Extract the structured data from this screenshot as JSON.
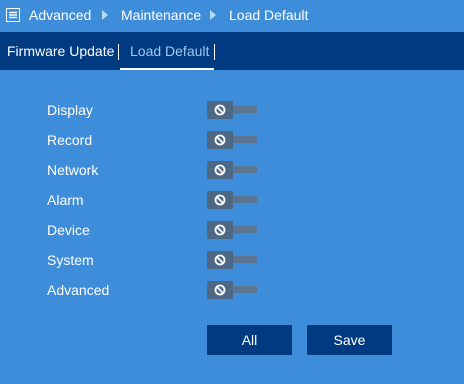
{
  "breadcrumb": {
    "items": [
      "Advanced",
      "Maintenance",
      "Load Default"
    ]
  },
  "tabs": [
    {
      "label": "Firmware Update",
      "active": false
    },
    {
      "label": "Load Default",
      "active": true
    }
  ],
  "settings": {
    "items": [
      {
        "label": "Display",
        "enabled": false
      },
      {
        "label": "Record",
        "enabled": false
      },
      {
        "label": "Network",
        "enabled": false
      },
      {
        "label": "Alarm",
        "enabled": false
      },
      {
        "label": "Device",
        "enabled": false
      },
      {
        "label": "System",
        "enabled": false
      },
      {
        "label": "Advanced",
        "enabled": false
      }
    ]
  },
  "buttons": {
    "all_label": "All",
    "save_label": "Save"
  },
  "colors": {
    "background": "#3e8ddb",
    "header_bar": "#003a80",
    "active_tab_text": "#9fc8f0",
    "toggle_off": "#4c6885"
  },
  "icons": {
    "breadcrumb_home": "menu-list-icon",
    "breadcrumb_separator": "triangle-right-icon",
    "toggle_state": "disabled-circle-icon"
  }
}
